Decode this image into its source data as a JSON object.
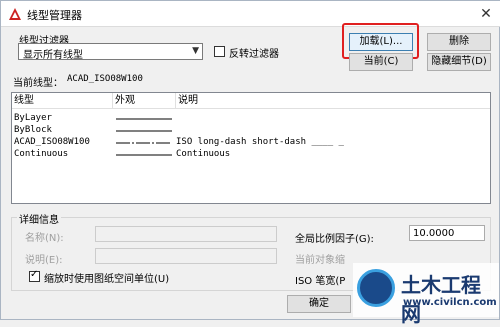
{
  "window": {
    "title": "线型管理器",
    "close_label": "✕"
  },
  "filter": {
    "group_label": "线型过滤器",
    "selected": "显示所有线型",
    "reverse_label": "反转过滤器",
    "reverse_checked": false
  },
  "buttons": {
    "load": "加载(L)...",
    "delete": "删除",
    "current": "当前(C)",
    "hide_details": "隐藏细节(D)",
    "ok": "确定"
  },
  "current_linetype": {
    "label": "当前线型：",
    "value": "ACAD_ISO08W100"
  },
  "table": {
    "headers": [
      "线型",
      "外观",
      "说明"
    ],
    "rows": [
      {
        "name": "ByLayer",
        "desc": ""
      },
      {
        "name": "ByBlock",
        "desc": ""
      },
      {
        "name": "ACAD_ISO08W100",
        "desc": "ISO long-dash short-dash ____ _"
      },
      {
        "name": "Continuous",
        "desc": "Continuous"
      }
    ]
  },
  "details": {
    "group_label": "详细信息",
    "name_label": "名称(N):",
    "desc_label": "说明(E):",
    "paper_units_label": "缩放时使用图纸空间单位(U)",
    "paper_units_checked": true,
    "global_scale_label": "全局比例因子(G):",
    "global_scale_value": "10.0000",
    "current_scale_label": "当前对象缩",
    "iso_pen_label": "ISO 笔宽(P"
  },
  "watermark": {
    "name": "土木工程网",
    "url": "www.civilcn.com"
  },
  "colors": {
    "highlight": "#e02020",
    "accent": "#3c7fb1",
    "logo": "#cc2222"
  }
}
